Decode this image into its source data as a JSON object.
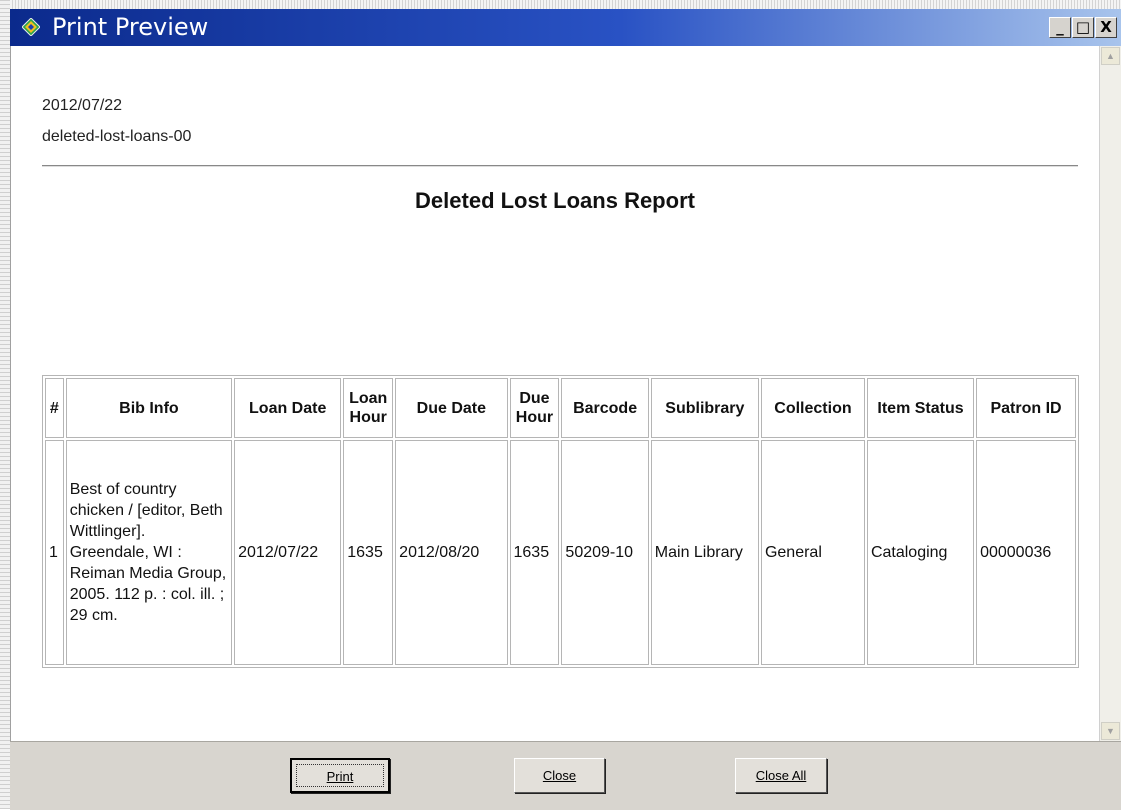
{
  "window": {
    "title": "Print Preview",
    "title_icon": "diamond-app-icon",
    "controls": {
      "minimize": "_",
      "maximize": "□",
      "close": "X"
    }
  },
  "report": {
    "date": "2012/07/22",
    "report_id": "deleted-lost-loans-00",
    "title": "Deleted Lost Loans Report",
    "columns": [
      "#",
      "Bib Info",
      "Loan Date",
      "Loan Hour",
      "Due Date",
      "Due Hour",
      "Barcode",
      "Sublibrary",
      "Collection",
      "Item Status",
      "Patron ID"
    ],
    "rows": [
      {
        "num": "1",
        "bib_info": "Best of country chicken / [editor, Beth Wittlinger]. Greendale, WI : Reiman Media Group, 2005. 112 p. : col. ill. ; 29 cm.",
        "loan_date": "2012/07/22",
        "loan_hour": "1635",
        "due_date": "2012/08/20",
        "due_hour": "1635",
        "barcode": "50209-10",
        "sublibrary": "Main Library",
        "collection": "General",
        "item_status": "Cataloging",
        "patron_id": "00000036"
      }
    ]
  },
  "buttons": {
    "print": "Print",
    "close": "Close",
    "close_all": "Close All"
  },
  "colors": {
    "title_bar_start": "#0b2a8c",
    "title_bar_end": "#a8c4ec",
    "button_face": "#d8d5cf"
  }
}
